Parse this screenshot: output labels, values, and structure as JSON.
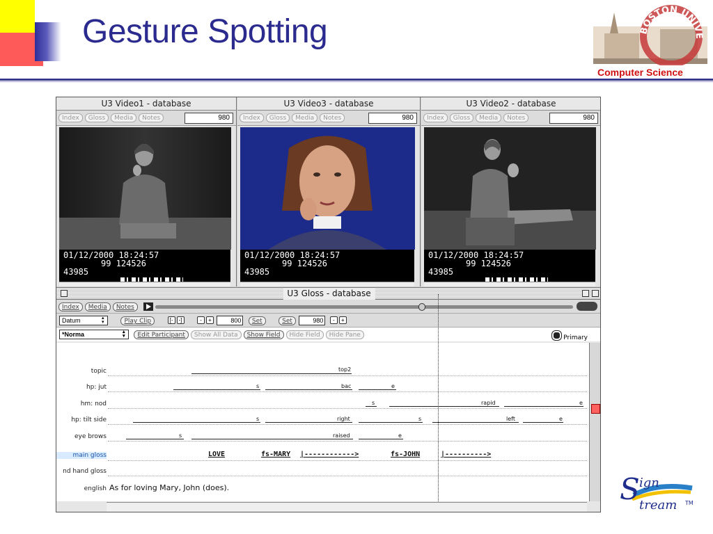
{
  "slide": {
    "title": "Gesture Spotting",
    "org_label": "Computer Science",
    "logo_text": "BOSTON UNIVERSITY"
  },
  "videos": [
    {
      "title": "U3 Video1 - database",
      "tabs": [
        "Index",
        "Gloss",
        "Media",
        "Notes"
      ],
      "frame": "980",
      "timecode": {
        "line1": "01/12/2000  18:24:57",
        "line2": "99    124526",
        "line3": "43985"
      }
    },
    {
      "title": "U3 Video3 - database",
      "tabs": [
        "Index",
        "Gloss",
        "Media",
        "Notes"
      ],
      "frame": "980",
      "timecode": {
        "line1": "01/12/2000  18:24:57",
        "line2": "99    124526",
        "line3": "43985"
      }
    },
    {
      "title": "U3 Video2 - database",
      "tabs": [
        "Index",
        "Gloss",
        "Media",
        "Notes"
      ],
      "frame": "980",
      "timecode": {
        "line1": "01/12/2000  18:24:57",
        "line2": "99    124526",
        "line3": "43985"
      }
    }
  ],
  "gloss": {
    "title": "U3 Gloss - database",
    "toolbar1": {
      "index": "Index",
      "media": "Media",
      "notes": "Notes",
      "playback_position": 0.64
    },
    "toolbar2": {
      "datum": "Datum",
      "play_clip": "Play Clip",
      "start_value": "800",
      "set1": "Set",
      "set2": "Set",
      "end_value": "980",
      "minus": "-",
      "plus": "+",
      "brackets": "[-",
      "brackets2": "-]"
    },
    "toolbar3": {
      "participant": "*Norma",
      "edit_participant": "Edit Participant",
      "show_all_data": "Show All Data",
      "show_field": "Show Field",
      "hide_field": "Hide Field",
      "hide_pane": "Hide Pane",
      "primary": "Primary"
    },
    "tiers": [
      {
        "label": "topic"
      },
      {
        "label": "hp: jut"
      },
      {
        "label": "hm: nod"
      },
      {
        "label": "hp: tilt side"
      },
      {
        "label": "eye brows"
      },
      {
        "label": "main gloss"
      },
      {
        "label": "nd hand gloss"
      },
      {
        "label": "english"
      }
    ],
    "tier_values": {
      "topic_top2": "top2",
      "jut_s": "s",
      "jut_bac": "bac",
      "jut_e": "e",
      "nod_s": "s",
      "nod_rapid": "rapid",
      "nod_e": "e",
      "tilt_s": "s",
      "tilt_right": "right",
      "tilt_s2": "s",
      "tilt_left": "left",
      "tilt_e": "e",
      "brows_s": "s",
      "brows_raised": "raised",
      "brows_e": "e"
    },
    "main_gloss": {
      "love": "LOVE",
      "mary": "fs-MARY",
      "arrow1": "|------------>",
      "john": "fs-JOHN",
      "arrow2": "|---------->"
    },
    "english": "As for loving Mary, John (does).",
    "sign_logo": "SignStream"
  }
}
